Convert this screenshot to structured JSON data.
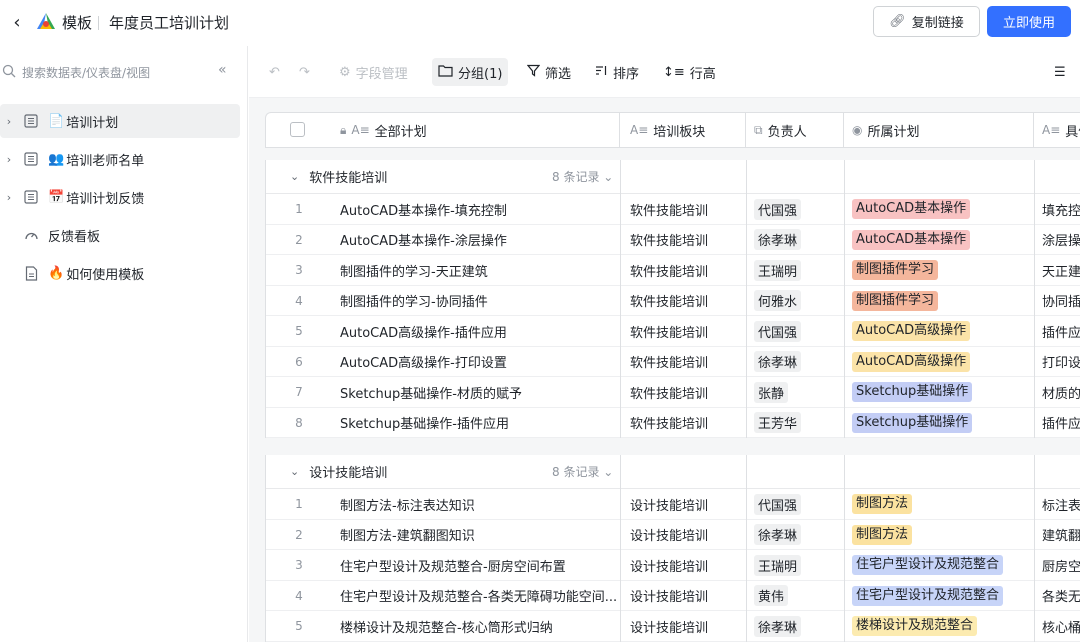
{
  "header": {
    "template_label": "模板",
    "doc_title": "年度员工培训计划",
    "copy_link_label": "复制链接",
    "use_now_label": "立即使用"
  },
  "sidebar": {
    "search_placeholder": "搜索数据表/仪表盘/视图",
    "items": [
      {
        "label": "培训计划",
        "emoji": "📄"
      },
      {
        "label": "培训老师名单",
        "emoji": "👥"
      },
      {
        "label": "培训计划反馈",
        "emoji": "📅"
      },
      {
        "label": "反馈看板",
        "emoji": ""
      },
      {
        "label": "如何使用模板",
        "emoji": "🔥"
      }
    ]
  },
  "toolbar": {
    "field_manage": "字段管理",
    "group": "分组(1)",
    "filter": "筛选",
    "sort": "排序",
    "row_height": "行高"
  },
  "columns": {
    "all_plans": "全部计划",
    "module": "培训板块",
    "owner": "负责人",
    "plan": "所属计划",
    "detail": "具体"
  },
  "colors": {
    "accent": "#3370ff",
    "tag_autocad_basic": "#f8c2c2",
    "tag_plugin": "#f4b69c",
    "tag_autocad_adv": "#fbe3a8",
    "tag_sketchup": "#c3cdf5",
    "tag_method": "#fbe2a0",
    "tag_residence": "#c7d4f8",
    "tag_stair": "#fcebb0"
  },
  "groups": [
    {
      "title": "软件技能培训",
      "count": "8 条记录",
      "rows": [
        {
          "num": "1",
          "name": "AutoCAD基本操作-填充控制",
          "module": "软件技能培训",
          "owner": "代国强",
          "plan": "AutoCAD基本操作",
          "tag": "autocad_basic",
          "detail": "填充控"
        },
        {
          "num": "2",
          "name": "AutoCAD基本操作-涂层操作",
          "module": "软件技能培训",
          "owner": "徐孝琳",
          "plan": "AutoCAD基本操作",
          "tag": "autocad_basic",
          "detail": "涂层操"
        },
        {
          "num": "3",
          "name": "制图插件的学习-天正建筑",
          "module": "软件技能培训",
          "owner": "王瑞明",
          "plan": "制图插件学习",
          "tag": "plugin",
          "detail": "天正建"
        },
        {
          "num": "4",
          "name": "制图插件的学习-协同插件",
          "module": "软件技能培训",
          "owner": "何雅水",
          "plan": "制图插件学习",
          "tag": "plugin",
          "detail": "协同插"
        },
        {
          "num": "5",
          "name": "AutoCAD高级操作-插件应用",
          "module": "软件技能培训",
          "owner": "代国强",
          "plan": "AutoCAD高级操作",
          "tag": "autocad_adv",
          "detail": "插件应"
        },
        {
          "num": "6",
          "name": "AutoCAD高级操作-打印设置",
          "module": "软件技能培训",
          "owner": "徐孝琳",
          "plan": "AutoCAD高级操作",
          "tag": "autocad_adv",
          "detail": "打印设"
        },
        {
          "num": "7",
          "name": "Sketchup基础操作-材质的赋予",
          "module": "软件技能培训",
          "owner": "张静",
          "plan": "Sketchup基础操作",
          "tag": "sketchup",
          "detail": "材质的"
        },
        {
          "num": "8",
          "name": "Sketchup基础操作-插件应用",
          "module": "软件技能培训",
          "owner": "王芳华",
          "plan": "Sketchup基础操作",
          "tag": "sketchup",
          "detail": "插件应"
        }
      ]
    },
    {
      "title": "设计技能培训",
      "count": "8 条记录",
      "rows": [
        {
          "num": "1",
          "name": "制图方法-标注表达知识",
          "module": "设计技能培训",
          "owner": "代国强",
          "plan": "制图方法",
          "tag": "method",
          "detail": "标注表"
        },
        {
          "num": "2",
          "name": "制图方法-建筑翻图知识",
          "module": "设计技能培训",
          "owner": "徐孝琳",
          "plan": "制图方法",
          "tag": "method",
          "detail": "建筑翻"
        },
        {
          "num": "3",
          "name": "住宅户型设计及规范整合-厨房空间布置",
          "module": "设计技能培训",
          "owner": "王瑞明",
          "plan": "住宅户型设计及规范整合",
          "tag": "residence",
          "detail": "厨房空"
        },
        {
          "num": "4",
          "name": "住宅户型设计及规范整合-各类无障碍功能空间...",
          "module": "设计技能培训",
          "owner": "黄伟",
          "plan": "住宅户型设计及规范整合",
          "tag": "residence",
          "detail": "各类无"
        },
        {
          "num": "5",
          "name": "楼梯设计及规范整合-核心筒形式归纳",
          "module": "设计技能培训",
          "owner": "徐孝琳",
          "plan": "楼梯设计及规范整合",
          "tag": "stair",
          "detail": "核心桶"
        }
      ]
    }
  ]
}
